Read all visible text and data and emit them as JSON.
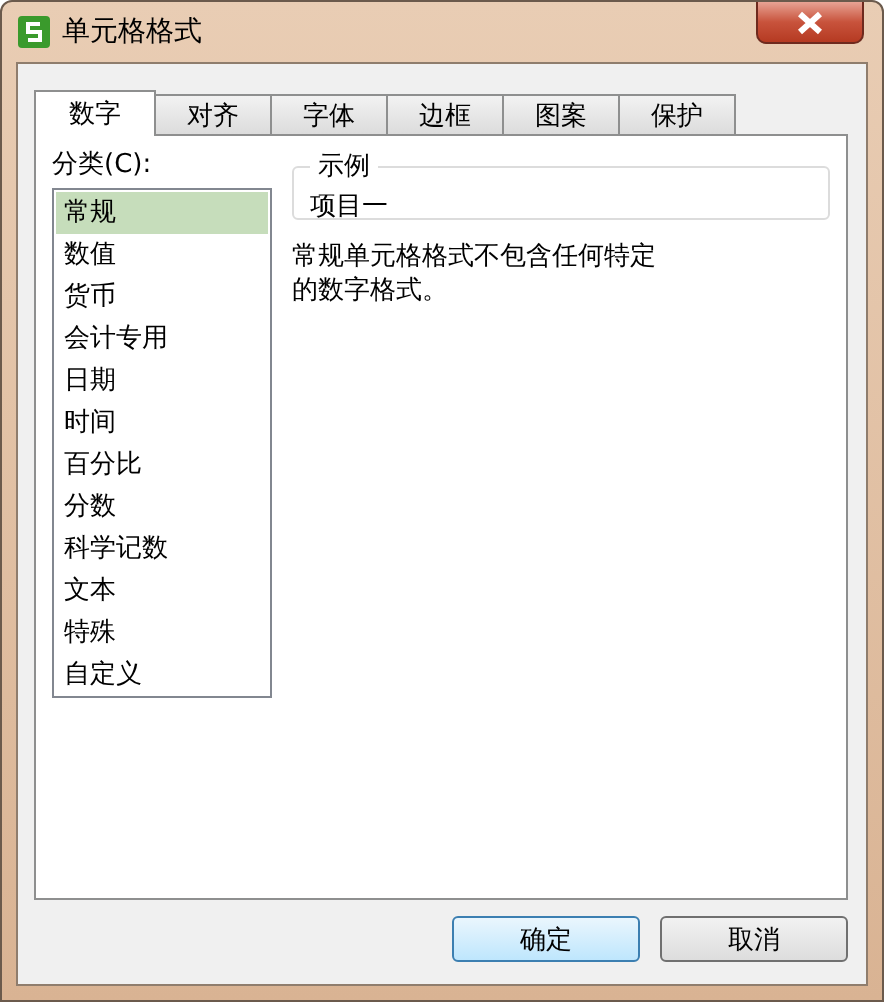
{
  "window": {
    "title": "单元格格式"
  },
  "tabs": [
    {
      "label": "数字",
      "selected": true
    },
    {
      "label": "对齐",
      "selected": false
    },
    {
      "label": "字体",
      "selected": false
    },
    {
      "label": "边框",
      "selected": false
    },
    {
      "label": "图案",
      "selected": false
    },
    {
      "label": "保护",
      "selected": false
    }
  ],
  "category": {
    "label": "分类(C):",
    "items": [
      {
        "label": "常规",
        "selected": true
      },
      {
        "label": "数值",
        "selected": false
      },
      {
        "label": "货币",
        "selected": false
      },
      {
        "label": "会计专用",
        "selected": false
      },
      {
        "label": "日期",
        "selected": false
      },
      {
        "label": "时间",
        "selected": false
      },
      {
        "label": "百分比",
        "selected": false
      },
      {
        "label": "分数",
        "selected": false
      },
      {
        "label": "科学记数",
        "selected": false
      },
      {
        "label": "文本",
        "selected": false
      },
      {
        "label": "特殊",
        "selected": false
      },
      {
        "label": "自定义",
        "selected": false
      }
    ]
  },
  "sample": {
    "legend": "示例",
    "value": "项目一"
  },
  "description": "常规单元格格式不包含任何特定的数字格式。",
  "buttons": [
    {
      "label": "确定",
      "kind": "default"
    },
    {
      "label": "取消",
      "kind": "normal"
    }
  ]
}
